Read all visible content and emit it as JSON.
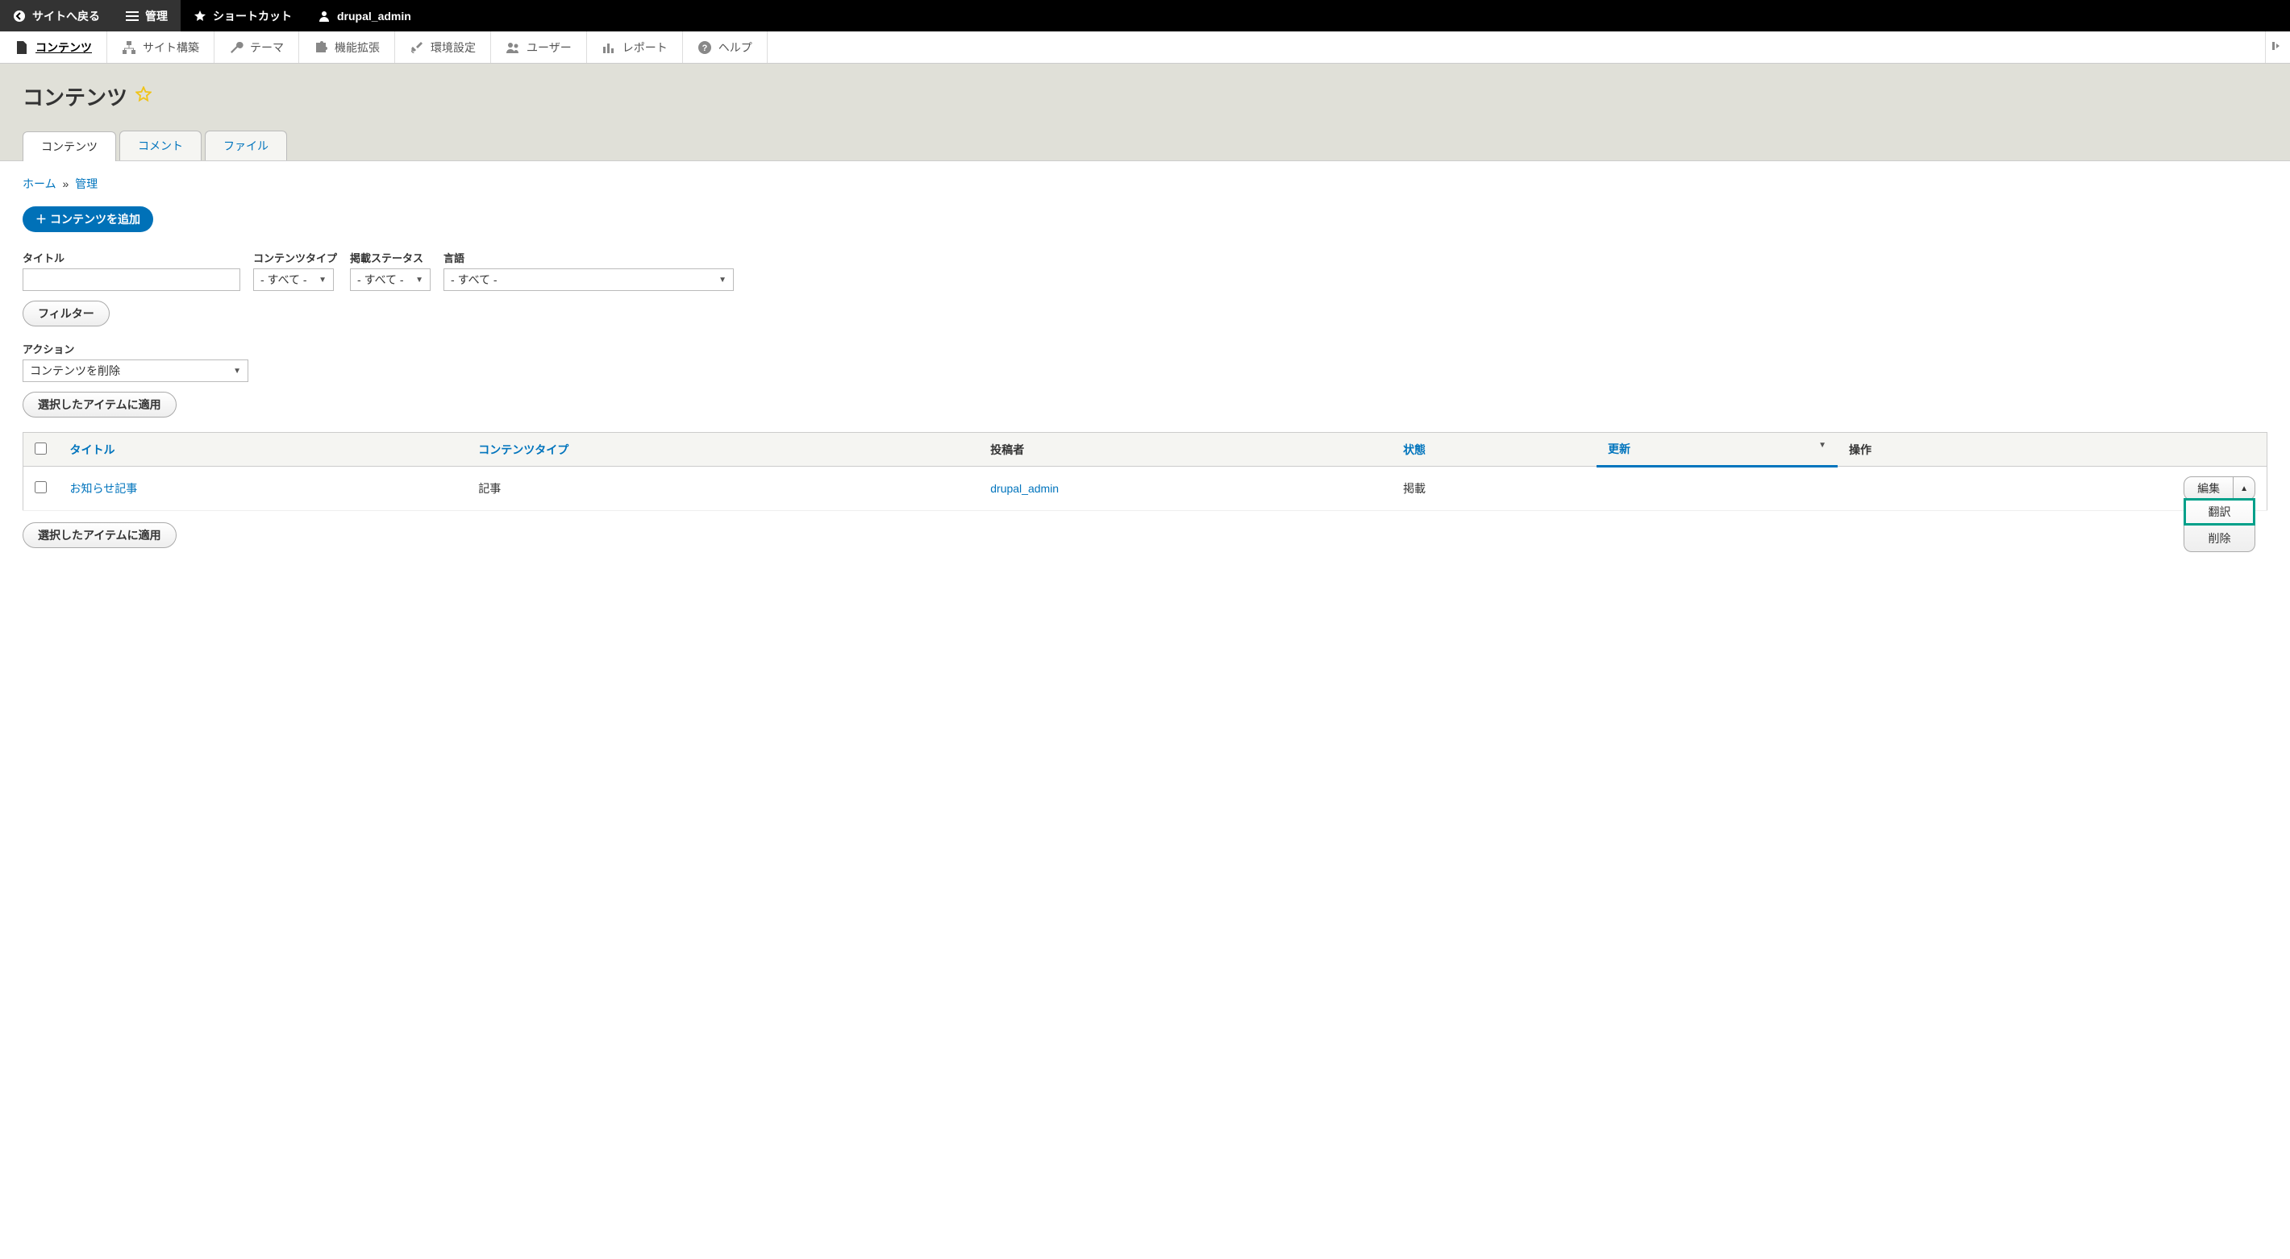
{
  "toolbar": {
    "back": "サイトへ戻る",
    "manage": "管理",
    "shortcuts": "ショートカット",
    "user": "drupal_admin"
  },
  "admin_menu": {
    "content": "コンテンツ",
    "structure": "サイト構築",
    "appearance": "テーマ",
    "extend": "機能拡張",
    "config": "環境設定",
    "people": "ユーザー",
    "reports": "レポート",
    "help": "ヘルプ"
  },
  "page": {
    "title": "コンテンツ"
  },
  "tabs": {
    "content": "コンテンツ",
    "comments": "コメント",
    "files": "ファイル"
  },
  "breadcrumb": {
    "home": "ホーム",
    "admin": "管理"
  },
  "buttons": {
    "add_content": "コンテンツを追加",
    "filter": "フィルター",
    "apply": "選択したアイテムに適用"
  },
  "filters": {
    "title_label": "タイトル",
    "type_label": "コンテンツタイプ",
    "status_label": "掲載ステータス",
    "lang_label": "言語",
    "all_option": "- すべて -",
    "action_label": "アクション",
    "action_value": "コンテンツを削除"
  },
  "table": {
    "headers": {
      "title": "タイトル",
      "type": "コンテンツタイプ",
      "author": "投稿者",
      "status": "状態",
      "updated": "更新",
      "ops": "操作"
    },
    "rows": [
      {
        "title": "お知らせ記事",
        "type": "記事",
        "author": "drupal_admin",
        "status": "掲載",
        "updated": ""
      }
    ]
  },
  "ops": {
    "edit": "編集",
    "translate": "翻訳",
    "delete": "削除"
  }
}
